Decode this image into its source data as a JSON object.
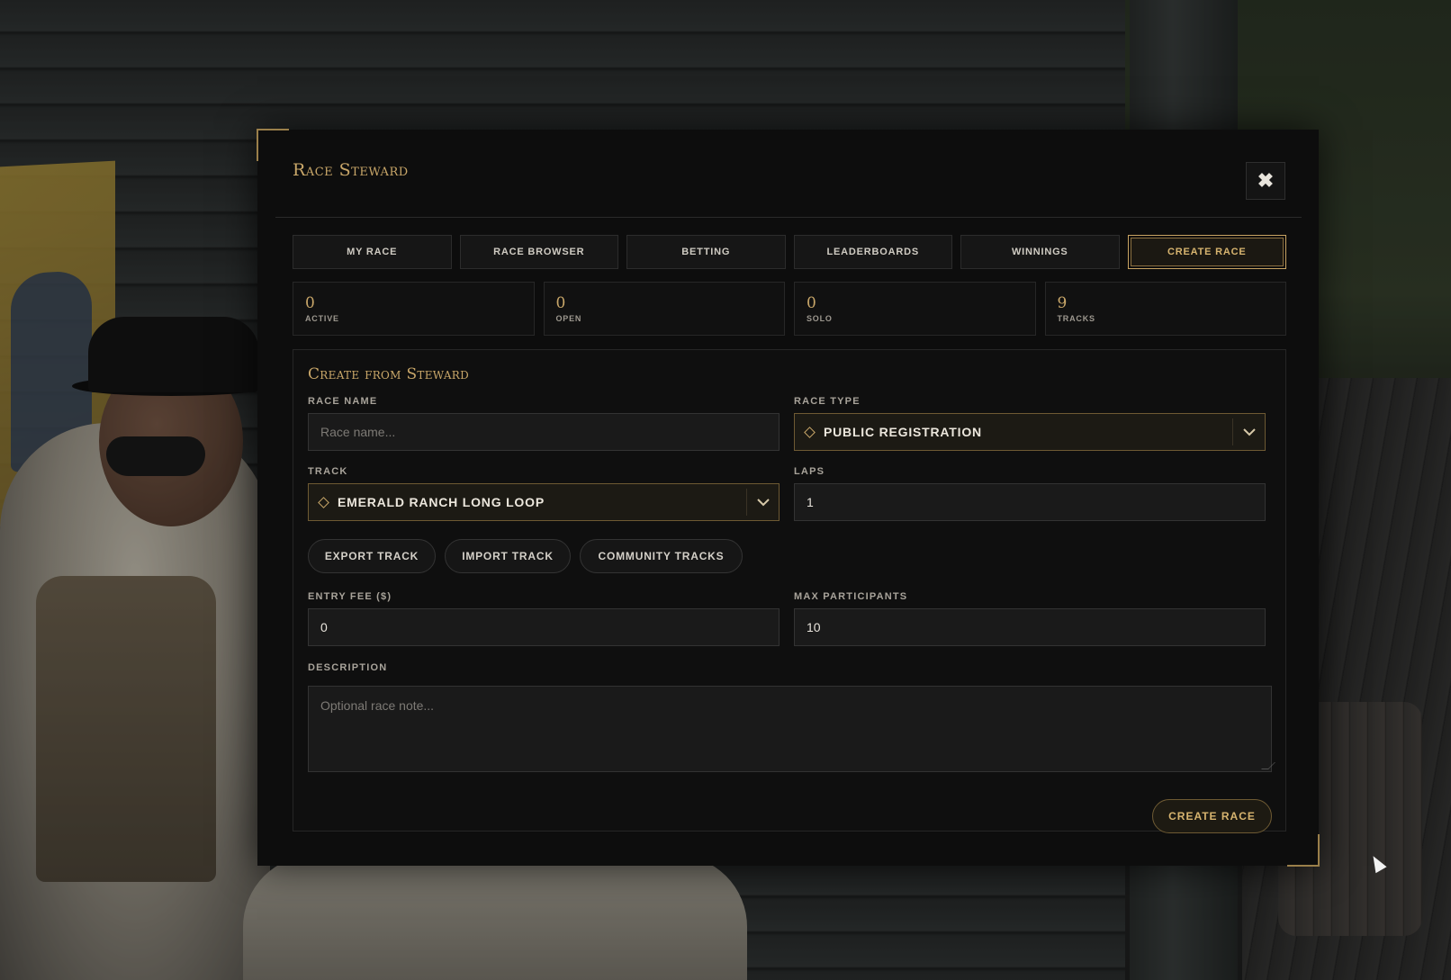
{
  "modal": {
    "title": "Race Steward",
    "close_icon": "close-x-icon"
  },
  "tabs": [
    {
      "label": "MY RACE",
      "active": false
    },
    {
      "label": "RACE BROWSER",
      "active": false
    },
    {
      "label": "BETTING",
      "active": false
    },
    {
      "label": "LEADERBOARDS",
      "active": false
    },
    {
      "label": "WINNINGS",
      "active": false
    },
    {
      "label": "CREATE RACE",
      "active": true
    }
  ],
  "stats": [
    {
      "value": "0",
      "label": "ACTIVE"
    },
    {
      "value": "0",
      "label": "OPEN"
    },
    {
      "value": "0",
      "label": "SOLO"
    },
    {
      "value": "9",
      "label": "TRACKS"
    }
  ],
  "form": {
    "title": "Create from Steward",
    "race_name": {
      "label": "RACE NAME",
      "value": "",
      "placeholder": "Race name..."
    },
    "race_type": {
      "label": "RACE TYPE",
      "value": "PUBLIC REGISTRATION"
    },
    "track": {
      "label": "TRACK",
      "value": "EMERALD RANCH LONG LOOP"
    },
    "laps": {
      "label": "LAPS",
      "value": "1"
    },
    "track_buttons": {
      "export": "EXPORT TRACK",
      "import": "IMPORT TRACK",
      "community": "COMMUNITY TRACKS"
    },
    "entry_fee": {
      "label": "ENTRY FEE ($)",
      "value": "0"
    },
    "max_participants": {
      "label": "MAX PARTICIPANTS",
      "value": "10"
    },
    "description": {
      "label": "DESCRIPTION",
      "value": "",
      "placeholder": "Optional race note..."
    },
    "submit_label": "CREATE RACE"
  },
  "colors": {
    "accent_gold": "#c9a769",
    "panel_bg": "#0d0d0d",
    "text_light": "#e8e4dc"
  }
}
